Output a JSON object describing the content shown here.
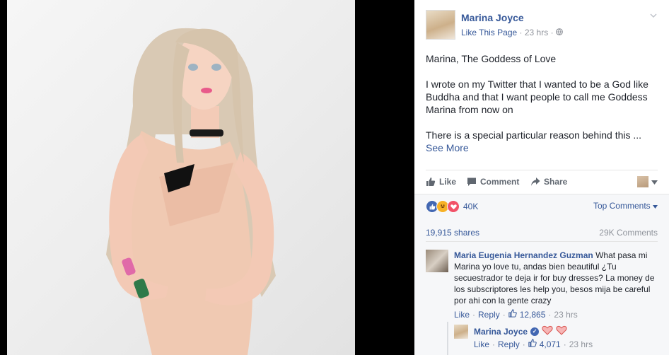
{
  "post": {
    "page_name": "Marina Joyce",
    "like_page_label": "Like This Page",
    "time": "23 hrs",
    "privacy_icon": "globe-icon",
    "text_title": "Marina, The Goddess of Love",
    "text_body": "I wrote on my Twitter that I wanted to be a God like Buddha and that I want people to call me Goddess Marina from now on",
    "text_tail": "There is a special particular reason behind this ...",
    "see_more": "See More"
  },
  "actions": {
    "like": "Like",
    "comment": "Comment",
    "share": "Share"
  },
  "stats": {
    "reaction_count": "40K",
    "sort_label": "Top Comments",
    "shares": "19,915 shares",
    "comments": "29K Comments"
  },
  "comment": {
    "author": "Maria Eugenia Hernandez Guzman",
    "text": "What pasa mi Marina yo love tu, andas bien beautiful ¿Tu secuestrador te deja ir for buy dresses? La money de los subscriptores les help you, besos mija be careful por ahi con la gente crazy",
    "like": "Like",
    "reply": "Reply",
    "likes": "12,865",
    "time": "23 hrs"
  },
  "reply": {
    "author": "Marina Joyce",
    "like": "Like",
    "reply": "Reply",
    "likes": "4,071",
    "time": "23 hrs"
  },
  "colors": {
    "link": "#365899",
    "muted": "#90949c",
    "like_blue": "#4267b2",
    "love_red": "#f25268",
    "haha_yellow": "#f7b125"
  }
}
